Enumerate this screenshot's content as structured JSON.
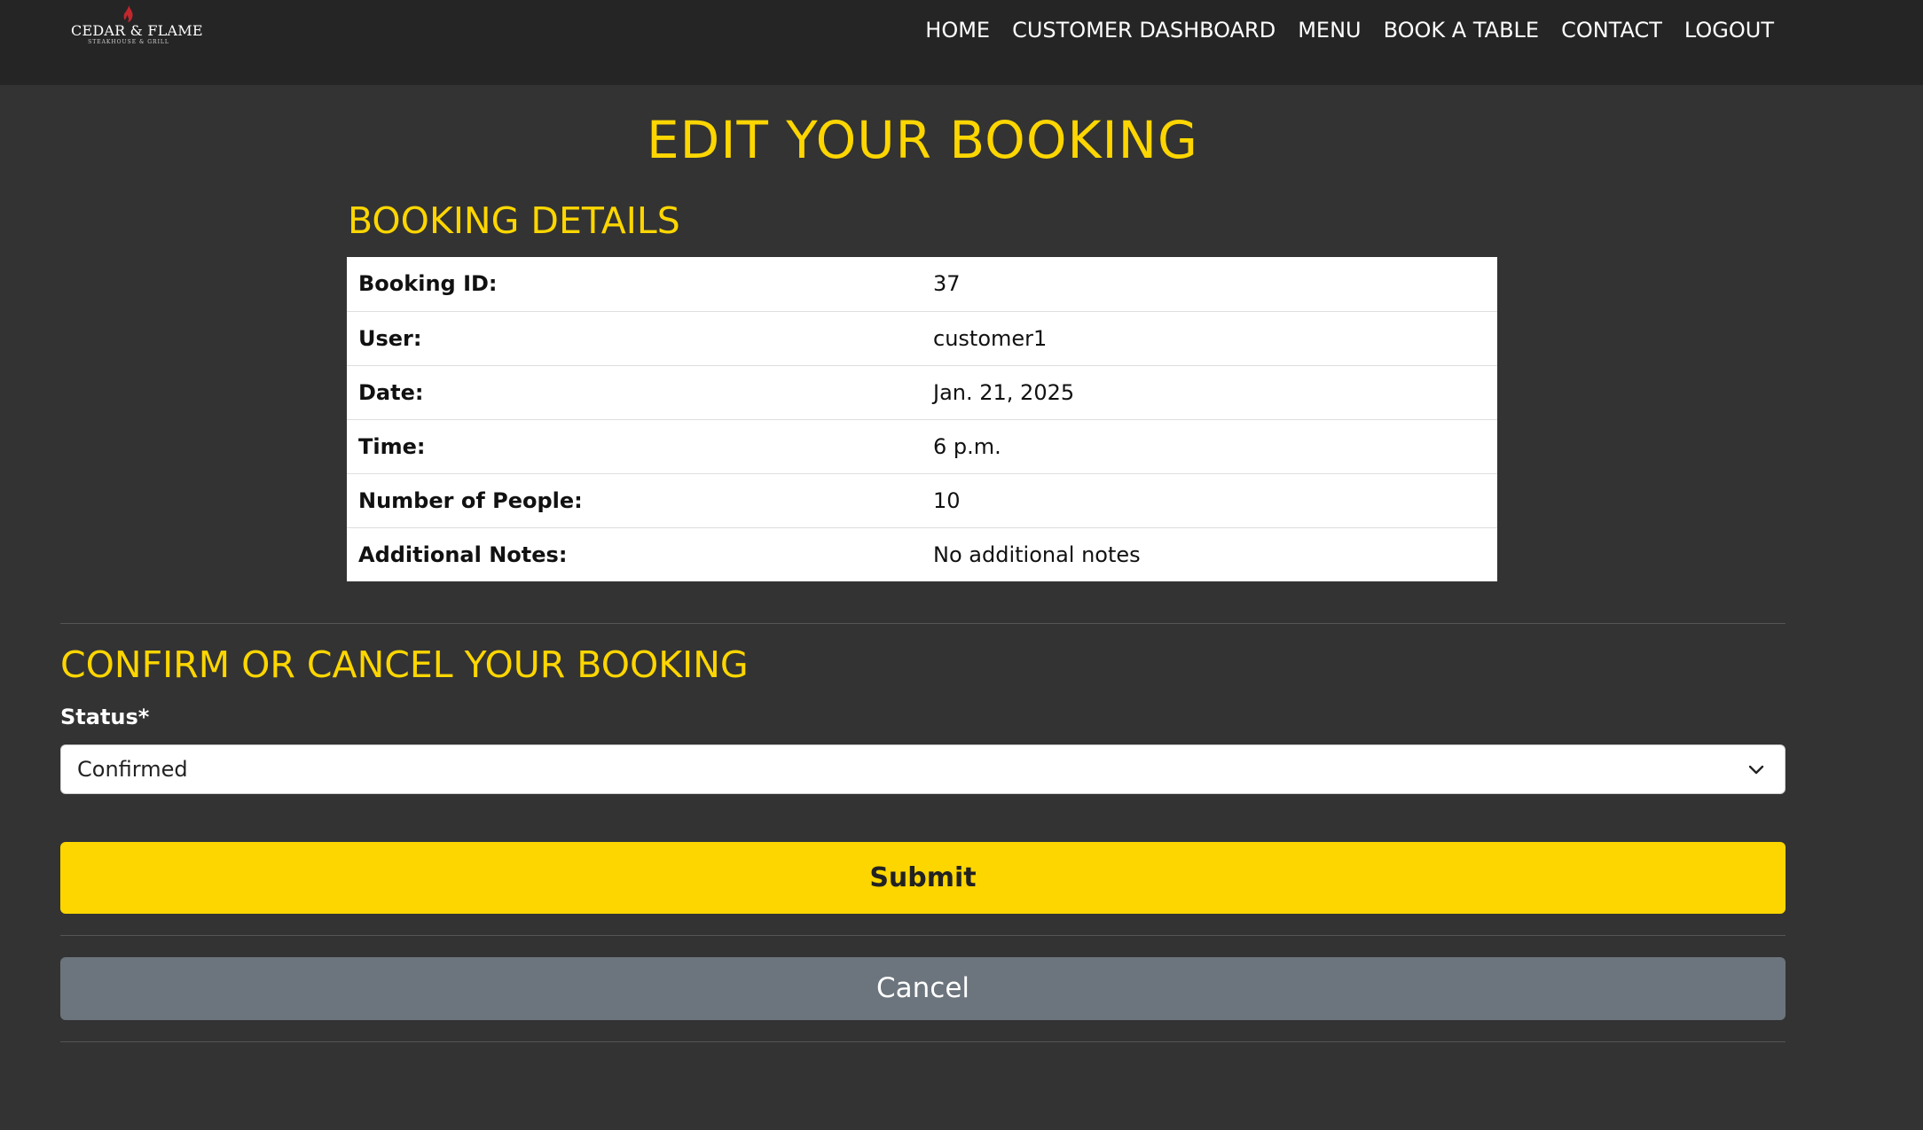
{
  "brand": {
    "name": "Cedar & Flame",
    "tagline": "STEAKHOUSE & GRILL"
  },
  "nav": {
    "items": [
      "HOME",
      "CUSTOMER DASHBOARD",
      "MENU",
      "BOOK A TABLE",
      "CONTACT",
      "LOGOUT"
    ]
  },
  "page": {
    "title": "EDIT YOUR BOOKING"
  },
  "details": {
    "heading": "BOOKING DETAILS",
    "rows": [
      {
        "label": "Booking ID:",
        "value": "37"
      },
      {
        "label": "User:",
        "value": "customer1"
      },
      {
        "label": "Date:",
        "value": "Jan. 21, 2025"
      },
      {
        "label": "Time:",
        "value": "6 p.m."
      },
      {
        "label": "Number of People:",
        "value": "10"
      },
      {
        "label": "Additional Notes:",
        "value": "No additional notes"
      }
    ]
  },
  "form": {
    "heading": "CONFIRM OR CANCEL YOUR BOOKING",
    "status_label": "Status*",
    "status_value": "Confirmed",
    "submit_label": "Submit",
    "cancel_label": "Cancel"
  },
  "colors": {
    "background": "#333333",
    "navbar": "#252525",
    "accent": "#fdd600",
    "cancel": "#6c757d",
    "flame": "#c1272d"
  },
  "icons": {
    "logo_flame": "flame-icon",
    "select_chevron": "chevron-down-icon"
  }
}
